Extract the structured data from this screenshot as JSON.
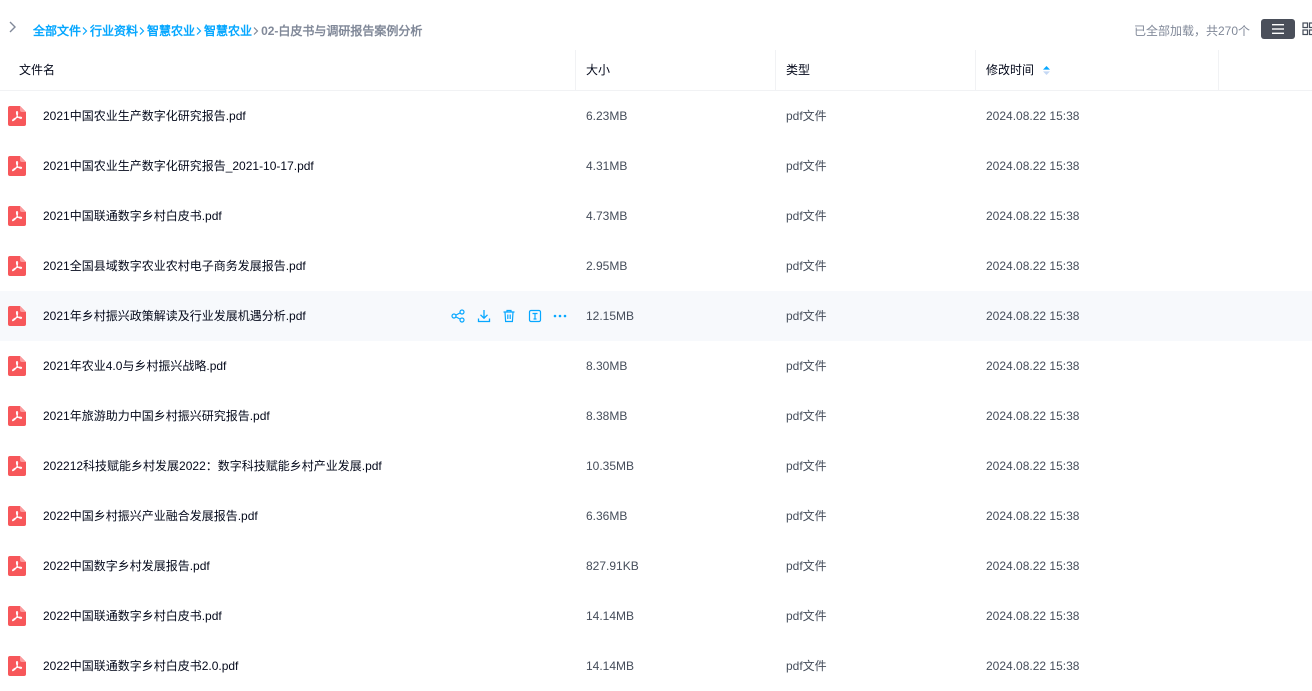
{
  "breadcrumb": {
    "items": [
      "全部文件",
      "行业资料",
      "智慧农业",
      "智慧农业"
    ],
    "current": "02-白皮书与调研报告案例分析"
  },
  "status": {
    "loaded_text": "已全部加载，共270个"
  },
  "table": {
    "columns": {
      "name": "文件名",
      "size": "大小",
      "type": "类型",
      "modified": "修改时间"
    },
    "rows": [
      {
        "name": "2021中国农业生产数字化研究报告.pdf",
        "size": "6.23MB",
        "type": "pdf文件",
        "modified": "2024.08.22 15:38"
      },
      {
        "name": "2021中国农业生产数字化研究报告_2021-10-17.pdf",
        "size": "4.31MB",
        "type": "pdf文件",
        "modified": "2024.08.22 15:38"
      },
      {
        "name": "2021中国联通数字乡村白皮书.pdf",
        "size": "4.73MB",
        "type": "pdf文件",
        "modified": "2024.08.22 15:38"
      },
      {
        "name": "2021全国县域数字农业农村电子商务发展报告.pdf",
        "size": "2.95MB",
        "type": "pdf文件",
        "modified": "2024.08.22 15:38"
      },
      {
        "name": "2021年乡村振兴政策解读及行业发展机遇分析.pdf",
        "size": "12.15MB",
        "type": "pdf文件",
        "modified": "2024.08.22 15:38"
      },
      {
        "name": "2021年农业4.0与乡村振兴战略.pdf",
        "size": "8.30MB",
        "type": "pdf文件",
        "modified": "2024.08.22 15:38"
      },
      {
        "name": "2021年旅游助力中国乡村振兴研究报告.pdf",
        "size": "8.38MB",
        "type": "pdf文件",
        "modified": "2024.08.22 15:38"
      },
      {
        "name": "202212科技赋能乡村发展2022：数字科技赋能乡村产业发展.pdf",
        "size": "10.35MB",
        "type": "pdf文件",
        "modified": "2024.08.22 15:38"
      },
      {
        "name": "2022中国乡村振兴产业融合发展报告.pdf",
        "size": "6.36MB",
        "type": "pdf文件",
        "modified": "2024.08.22 15:38"
      },
      {
        "name": "2022中国数字乡村发展报告.pdf",
        "size": "827.91KB",
        "type": "pdf文件",
        "modified": "2024.08.22 15:38"
      },
      {
        "name": "2022中国联通数字乡村白皮书.pdf",
        "size": "14.14MB",
        "type": "pdf文件",
        "modified": "2024.08.22 15:38"
      },
      {
        "name": "2022中国联通数字乡村白皮书2.0.pdf",
        "size": "14.14MB",
        "type": "pdf文件",
        "modified": "2024.08.22 15:38"
      }
    ]
  },
  "icons": {
    "file": "pdf-file-icon",
    "row_actions": [
      "share-icon",
      "download-icon",
      "delete-icon",
      "rename-icon",
      "more-icon"
    ]
  },
  "colors": {
    "link": "#06a7ff",
    "pdf": "#f7575a",
    "hover_row": "#f7f9fc",
    "muted": "#818999"
  }
}
